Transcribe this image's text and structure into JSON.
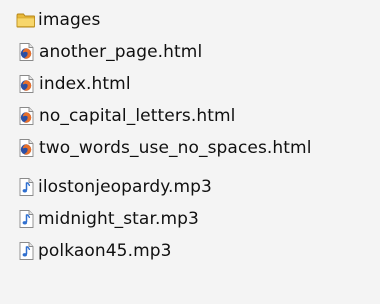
{
  "files": [
    {
      "name": "images",
      "type": "folder",
      "icon": "folder-icon"
    },
    {
      "name": "another_page.html",
      "type": "html",
      "icon": "firefox-html-icon"
    },
    {
      "name": "index.html",
      "type": "html",
      "icon": "firefox-html-icon"
    },
    {
      "name": "no_capital_letters.html",
      "type": "html",
      "icon": "firefox-html-icon"
    },
    {
      "name": "two_words_use_no_spaces.html",
      "type": "html",
      "icon": "firefox-html-icon"
    },
    {
      "name": "ilostonjeopardy.mp3",
      "type": "audio",
      "icon": "audio-note-icon"
    },
    {
      "name": "midnight_star.mp3",
      "type": "audio",
      "icon": "audio-note-icon"
    },
    {
      "name": "polkaon45.mp3",
      "type": "audio",
      "icon": "audio-note-icon"
    }
  ]
}
